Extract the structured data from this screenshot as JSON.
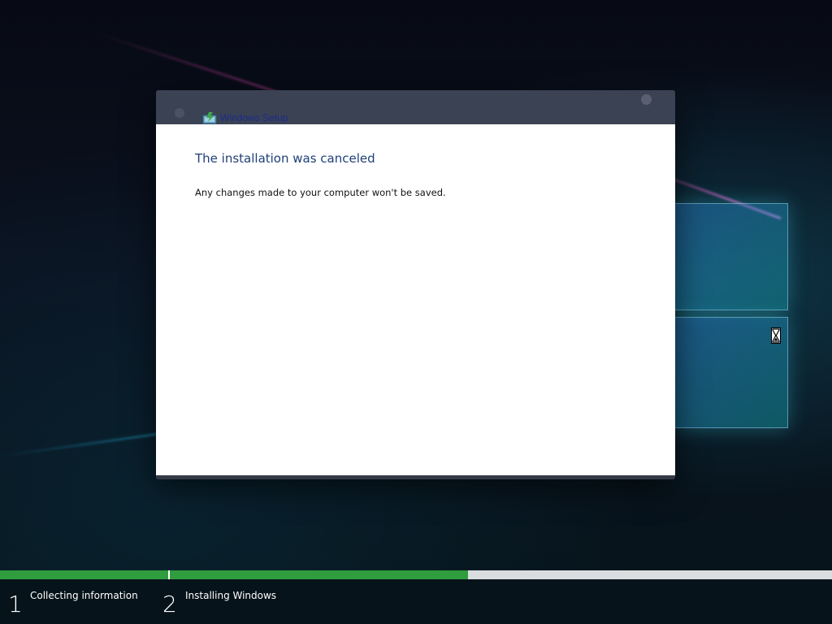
{
  "window": {
    "title": "Windows Setup",
    "heading": "The installation was canceled",
    "message": "Any changes made to your computer won't be saved."
  },
  "progress": {
    "step1_fraction": 1.0,
    "step2_fraction": 0.45
  },
  "steps": [
    {
      "number": "1",
      "label": "Collecting information"
    },
    {
      "number": "2",
      "label": "Installing Windows"
    }
  ],
  "colors": {
    "progress_fill": "#2f9c3e",
    "heading": "#1f3f78",
    "title_text": "#1c2b8a"
  },
  "icons": {
    "setup": "windows-setup-icon",
    "cursor": "hourglass-busy-cursor"
  }
}
